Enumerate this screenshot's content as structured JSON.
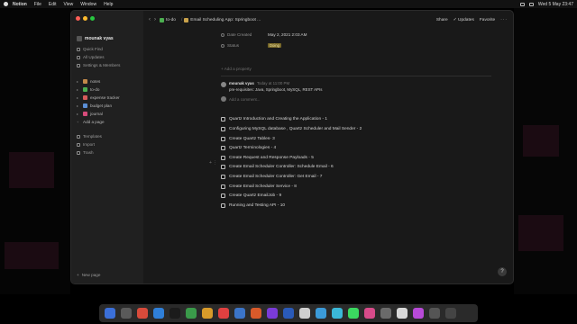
{
  "menubar": {
    "app": "Notion",
    "items": [
      "File",
      "Edit",
      "View",
      "Window",
      "Help"
    ],
    "clock": "Wed 5 May 23:47"
  },
  "window": {
    "topbar": {
      "crumb1": "to-do",
      "crumb2": "Email Scheduling App: Springboot ...",
      "share": "Share",
      "updates": "Updates",
      "favorite": "Favorite",
      "more": "···"
    },
    "sidebar": {
      "workspace": "mounak vyas",
      "links": [
        "Quick Find",
        "All Updates",
        "Settings & Members"
      ],
      "pages": [
        {
          "label": "notes",
          "color": "#c48a4a"
        },
        {
          "label": "to-do",
          "color": "#4caf50"
        },
        {
          "label": "expense tracker",
          "color": "#d65b5b"
        },
        {
          "label": "budget plan",
          "color": "#5b8fd6"
        },
        {
          "label": "journal",
          "color": "#d64b7a"
        }
      ],
      "add_page": "Add a page",
      "bottom_links": [
        "Templates",
        "Import",
        "Trash"
      ],
      "new_page": "New page"
    },
    "properties": {
      "date_label": "Date Created",
      "date_value": "May 2, 2021 2:03 AM",
      "status_label": "Status",
      "status_value": "Doing",
      "add_property": "Add a property"
    },
    "comment": {
      "author": "mounak vyas",
      "time": "Today at 11:00 PM",
      "text": "pre-requisites: Java, Springboot, MySQL, REST APIs",
      "add_placeholder": "Add a comment..."
    },
    "todos": [
      "Quartz Introduction and Creating the Application - 1",
      "Configuring MySQL database , Quartz Scheduler and Mail Sender - 2",
      "Create Quartz Tables- 3",
      "Quartz Terminologies - 4",
      "Create Request and Response Payloads - 5",
      "Create Email Scheduler Controller: Schedule Email  - 6",
      "Create Email Scheduler Controller: Get Email  - 7",
      "Create Email Scheduler Service - 8",
      "Create Quartz EmailJob - 9",
      "Running and Testing API - 10"
    ],
    "help": "?"
  },
  "dock": {
    "colors": [
      "#3b6fd8",
      "#5a5a5a",
      "#d84b3b",
      "#2f7fd8",
      "#1b1b1b",
      "#3a9a4a",
      "#d89b2a",
      "#e04040",
      "#3b74c8",
      "#d85a2a",
      "#7a3bd8",
      "#2a5ab8",
      "#cfcfcf",
      "#3b9ad8",
      "#3bb8d8",
      "#3bd860",
      "#d84b8a",
      "#6a6a6a",
      "#d8d8d8",
      "#b84ad8",
      "#555",
      "#444",
      "#2a2a2a"
    ]
  }
}
